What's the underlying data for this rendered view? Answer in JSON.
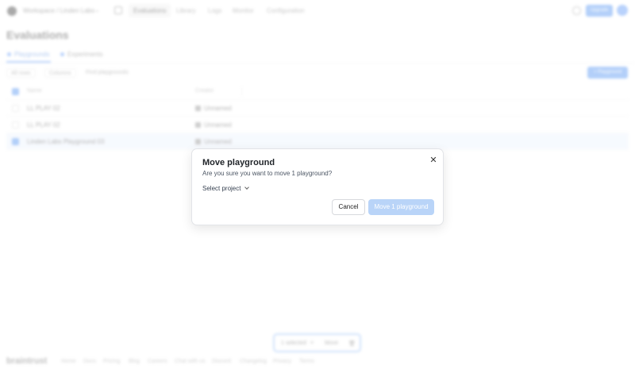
{
  "nav": {
    "org": "Workspace / Linden Labs",
    "tabs": [
      "Evaluations",
      "Library",
      "Logs",
      "Monitor",
      "Configuration"
    ],
    "upgrade_label": "Upgrade"
  },
  "page": {
    "title": "Evaluations"
  },
  "subtabs": [
    "Playgrounds",
    "Experiments"
  ],
  "toolbar": {
    "filter_view": "All rows",
    "columns": "Columns",
    "search_placeholder": "Find playgrounds",
    "new_label": "+ Playground"
  },
  "table": {
    "headers": {
      "name": "Name",
      "creator": "Creator"
    },
    "rows": [
      {
        "name": "LL PLAY 02",
        "creator": "Unnamed",
        "selected": false
      },
      {
        "name": "LL PLAY 02",
        "creator": "Unnamed",
        "selected": false
      },
      {
        "name": "Linden Labs Playground 03",
        "creator": "Unnamed",
        "selected": true
      }
    ]
  },
  "bulk_bar": {
    "selected": "1 selected",
    "move": "Move"
  },
  "footer": {
    "logo": "braintrust",
    "links": [
      "Home",
      "Docs",
      "Pricing",
      "Blog",
      "Careers",
      "Chat with us",
      "Discord",
      "Changelog",
      "Privacy",
      "Terms"
    ]
  },
  "modal": {
    "title": "Move playground",
    "description": "Are you sure you want to move 1 playground?",
    "select_label": "Select project",
    "cancel_label": "Cancel",
    "confirm_label": "Move 1 playground"
  },
  "colors": {
    "accent": "#2b7bef",
    "confirm_disabled": "#b9d4f8"
  }
}
